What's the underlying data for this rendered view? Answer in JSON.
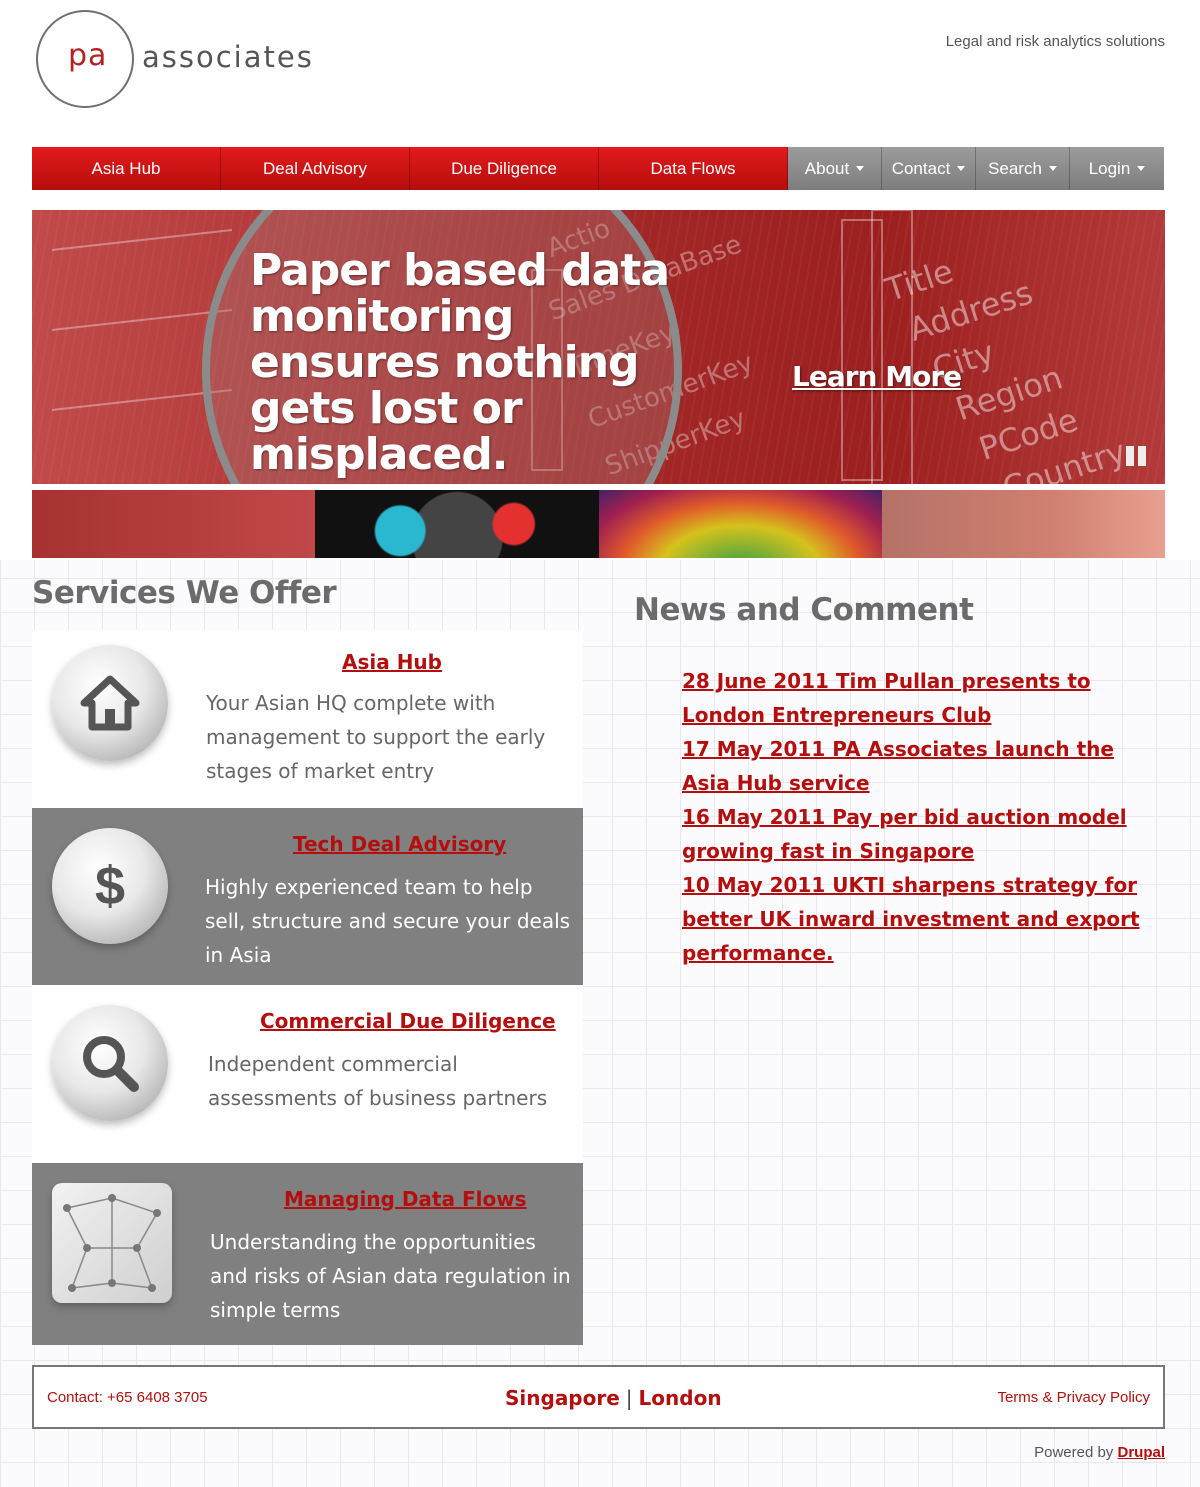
{
  "header": {
    "logo_pa": "pa",
    "logo_associates": "associates",
    "tagline": "Legal and risk analytics solutions"
  },
  "nav": {
    "primary": [
      "Asia Hub",
      "Deal Advisory",
      "Due Diligence",
      "Data Flows"
    ],
    "secondary": [
      "About",
      "Contact",
      "Search",
      "Login"
    ]
  },
  "hero": {
    "headline": "Paper based data monitoring ensures nothing gets lost or misplaced.",
    "link": "Learn More",
    "bg_words_left": [
      "Actio",
      "Sales DataBase",
      "TimeKey",
      "CustomerKey",
      "ShipperKey"
    ],
    "bg_words_right": [
      "Title",
      "Address",
      "City",
      "Region",
      "PCode",
      "Country"
    ]
  },
  "services": {
    "title": "Services We Offer",
    "items": [
      {
        "title": "Asia Hub",
        "text": "Your Asian HQ complete with management to support the early stages of market entry",
        "icon": "house-icon"
      },
      {
        "title": "Tech Deal Advisory",
        "text": "Highly experienced team to help sell, structure and secure your deals in Asia",
        "icon": "dollar-icon"
      },
      {
        "title": "Commercial Due Diligence",
        "text": "Independent commercial assessments of business partners",
        "icon": "magnifier-icon"
      },
      {
        "title": "Managing Data Flows",
        "text": "Understanding the opportunities and risks of Asian data regulation in simple terms",
        "icon": "network-icon"
      }
    ]
  },
  "news": {
    "title": "News and Comment",
    "items": [
      "28 June 2011 Tim Pullan presents to London Entrepreneurs Club",
      "17 May 2011 PA Associates launch the Asia Hub service",
      "16 May 2011 Pay per bid auction model growing fast in Singapore",
      "10 May 2011 UKTI sharpens strategy for better UK inward investment and export performance."
    ]
  },
  "footer": {
    "contact": "Contact: +65 6408 3705",
    "city1": "Singapore",
    "separator": "|",
    "city2": "London",
    "terms": "Terms & Privacy Policy",
    "powered_by": "Powered by",
    "drupal": "Drupal"
  },
  "colors": {
    "brand_red": "#b30f0f",
    "nav_red": "#d81616",
    "nav_grey": "#8c8c8c"
  }
}
